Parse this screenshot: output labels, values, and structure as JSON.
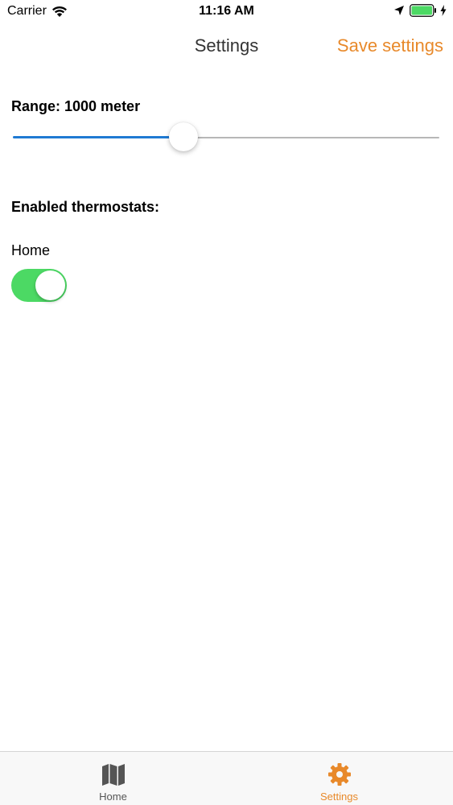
{
  "status_bar": {
    "carrier": "Carrier",
    "time": "11:16 AM"
  },
  "nav": {
    "title": "Settings",
    "save_label": "Save settings"
  },
  "range": {
    "label": "Range: 1000 meter",
    "slider_fraction": 0.4
  },
  "thermostats": {
    "heading": "Enabled thermostats:",
    "items": [
      {
        "label": "Home",
        "enabled": true
      }
    ]
  },
  "tab_bar": {
    "tabs": [
      {
        "label": "Home",
        "icon": "map-icon",
        "active": false
      },
      {
        "label": "Settings",
        "icon": "gear-icon",
        "active": true
      }
    ]
  },
  "colors": {
    "accent": "#e8892a",
    "slider_active": "#1f7ad3",
    "toggle_on": "#4cd964",
    "battery": "#4cd964"
  }
}
